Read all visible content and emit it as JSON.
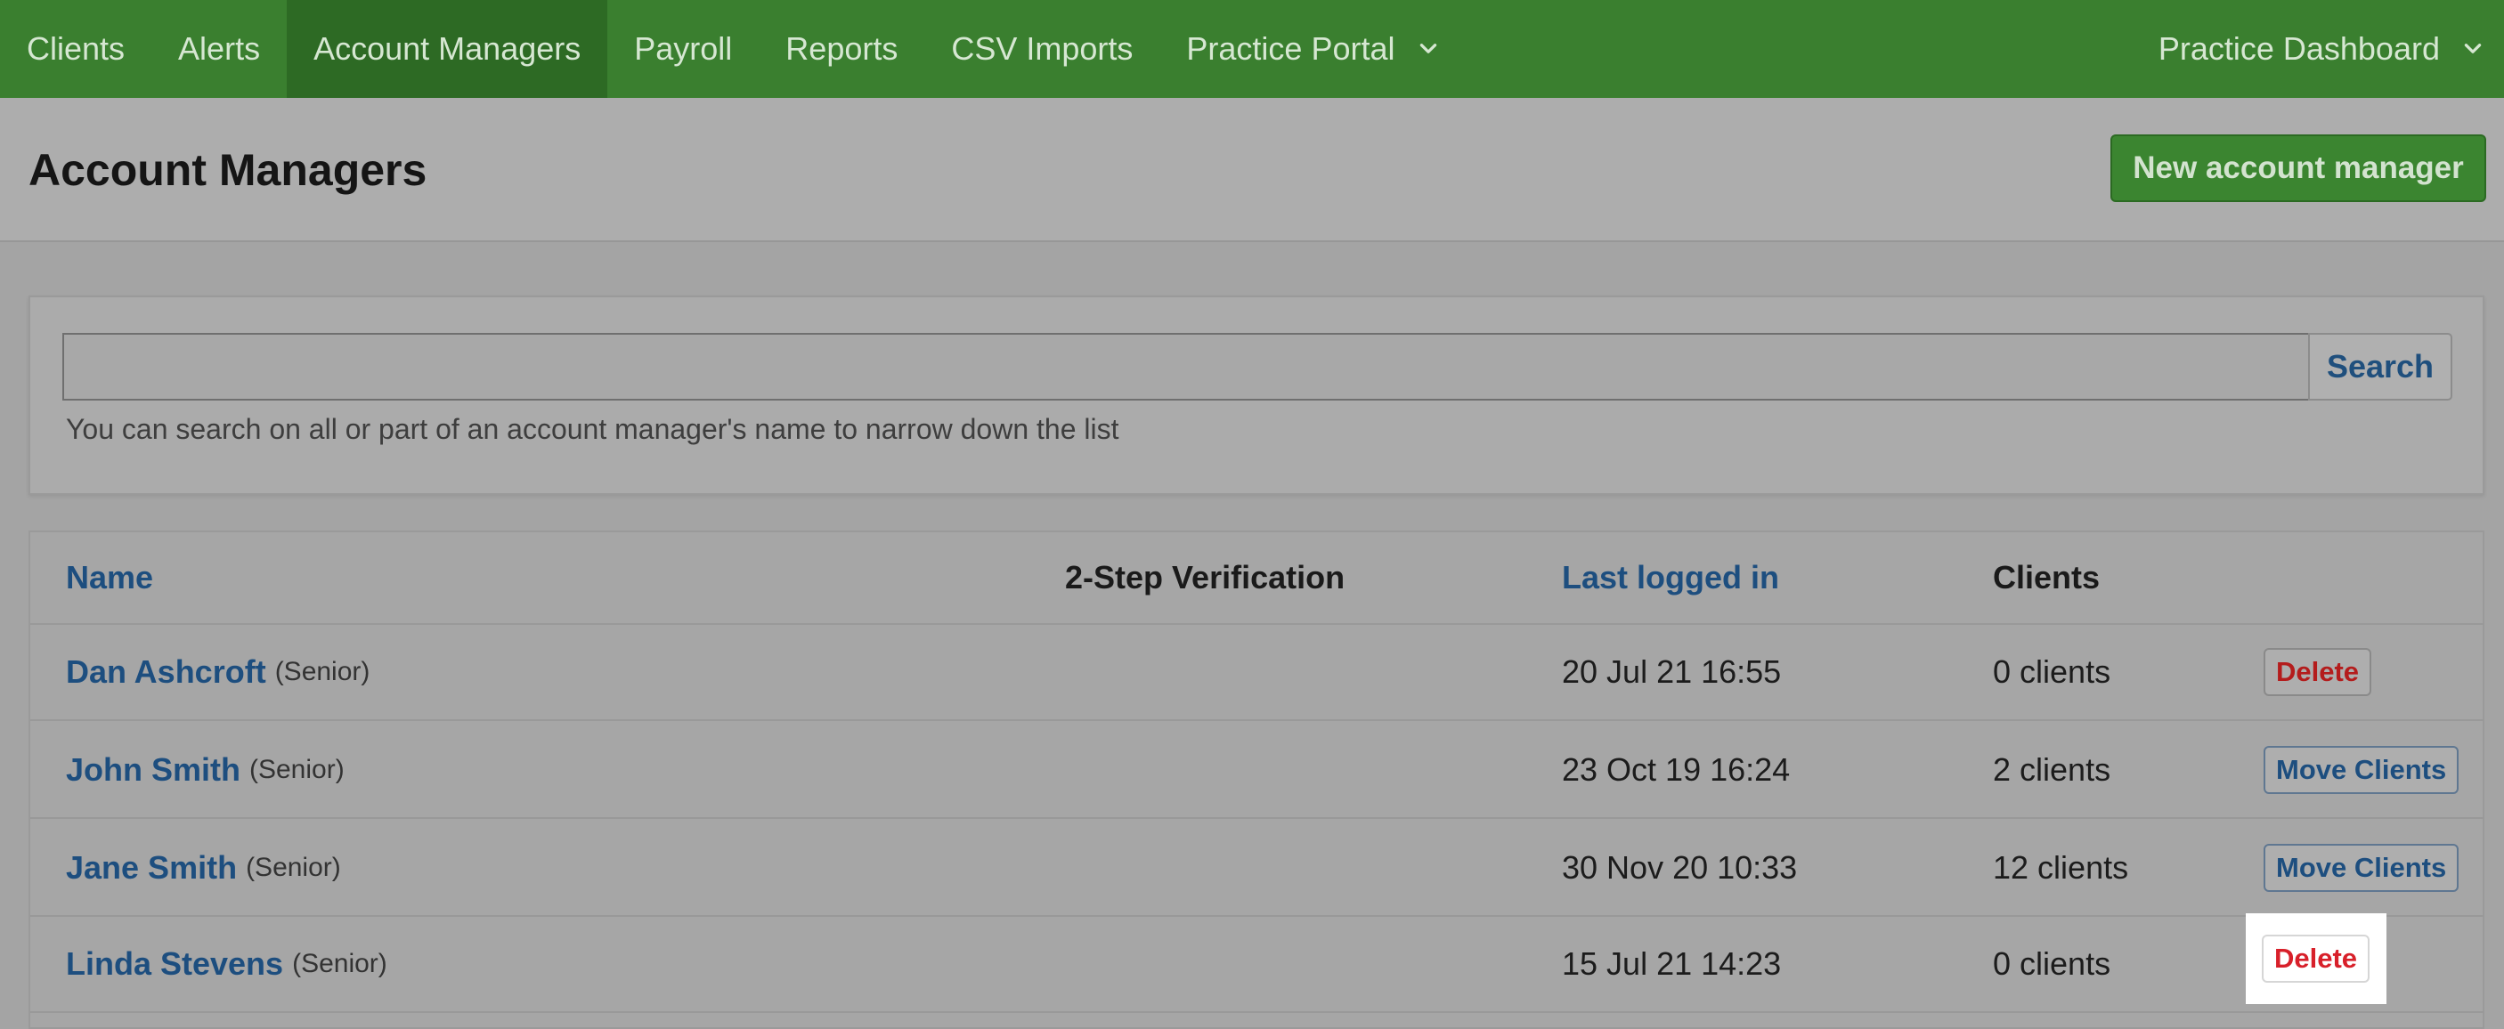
{
  "nav": {
    "items": [
      {
        "label": "Clients"
      },
      {
        "label": "Alerts"
      },
      {
        "label": "Account Managers",
        "active": true
      },
      {
        "label": "Payroll"
      },
      {
        "label": "Reports"
      },
      {
        "label": "CSV Imports"
      },
      {
        "label": "Practice Portal",
        "dropdown": true
      }
    ],
    "right": {
      "label": "Practice Dashboard",
      "dropdown": true
    },
    "colors": {
      "bar": "#3a7f2f",
      "active": "#2d6a24"
    }
  },
  "header": {
    "title": "Account Managers",
    "new_button": "New account manager"
  },
  "search": {
    "value": "",
    "placeholder": "",
    "button": "Search",
    "help": "You can search on all or part of an account manager's name to narrow down the list"
  },
  "table": {
    "columns": {
      "name": "Name",
      "two_step": "2-Step Verification",
      "last_logged_in": "Last logged in",
      "clients": "Clients"
    },
    "rows": [
      {
        "name": "Dan Ashcroft",
        "role": "(Senior)",
        "two_step": "",
        "last_logged_in": "20 Jul 21 16:55",
        "clients": "0 clients",
        "action": "Delete"
      },
      {
        "name": "John Smith",
        "role": "(Senior)",
        "two_step": "",
        "last_logged_in": "23 Oct 19 16:24",
        "clients": "2 clients",
        "action": "Move Clients"
      },
      {
        "name": "Jane Smith",
        "role": "(Senior)",
        "two_step": "",
        "last_logged_in": "30 Nov 20 10:33",
        "clients": "12 clients",
        "action": "Move Clients"
      },
      {
        "name": "Linda Stevens",
        "role": "(Senior)",
        "two_step": "",
        "last_logged_in": "15 Jul 21 14:23",
        "clients": "0 clients",
        "action": "Delete"
      }
    ]
  }
}
